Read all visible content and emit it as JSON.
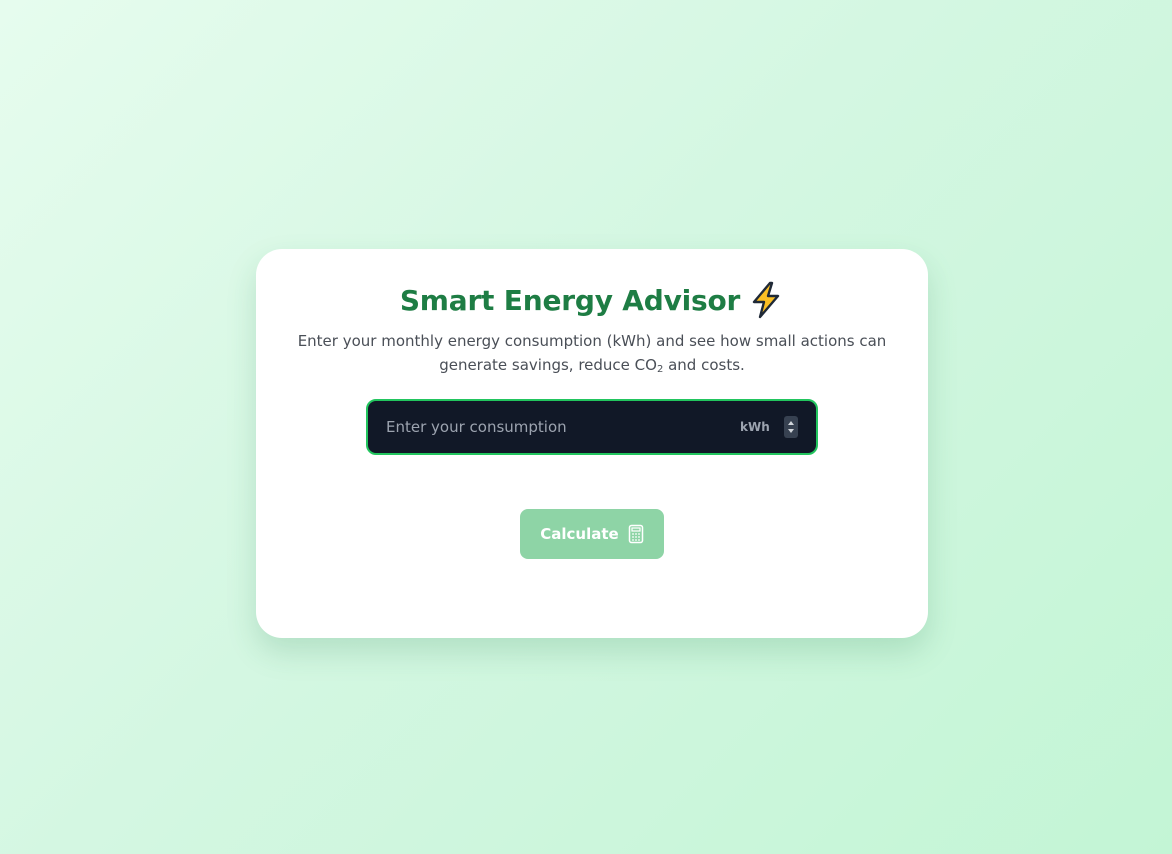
{
  "app": {
    "title": "Smart Energy Advisor",
    "title_icon": "lightning-bolt-icon",
    "description_before": "Enter your monthly energy consumption (kWh) and see how small actions can generate savings, reduce CO",
    "description_sub": "2",
    "description_after": " and costs."
  },
  "consumption_input": {
    "placeholder": "Enter your consumption",
    "value": "",
    "unit": "kWh"
  },
  "calculate_button": {
    "label": "Calculate",
    "icon": "calculator-icon",
    "state": "disabled"
  },
  "colors": {
    "accent": "#1e7d44",
    "input_border": "#22c55e",
    "input_background": "#111827",
    "button_background": "#8ed4a6",
    "bolt_fill": "#fbbf24"
  }
}
